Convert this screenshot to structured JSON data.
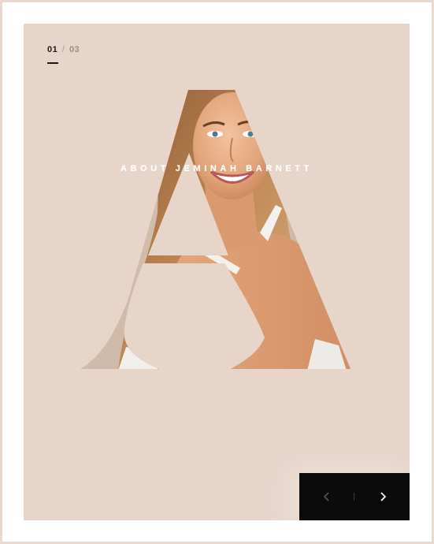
{
  "slider": {
    "current": "01",
    "separator": "/",
    "total": "03"
  },
  "hero": {
    "letter": "A",
    "heading": "ABOUT JEMINAH BARNETT"
  },
  "nav": {
    "prev_icon": "chevron-left-icon",
    "next_icon": "chevron-right-icon"
  },
  "colors": {
    "background": "#e7d5ca",
    "frame": "#ffffff",
    "nav_background": "#0b0b0b",
    "skin": "#e3a97f",
    "hair": "#c08853"
  }
}
